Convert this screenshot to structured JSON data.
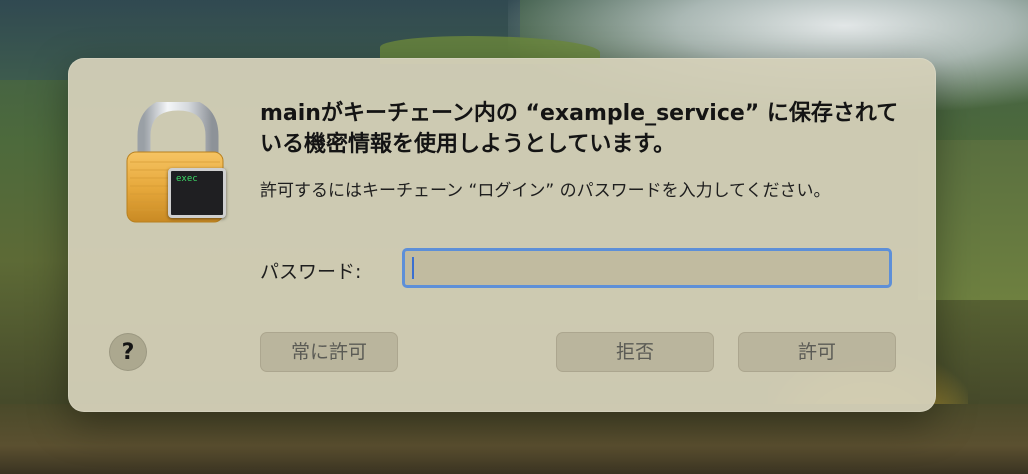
{
  "dialog": {
    "title": "mainがキーチェーン内の “example_service” に保存されている機密情報を使用しようとしています。",
    "message": "許可するにはキーチェーン “ログイン” のパスワードを入力してください。",
    "password_label": "パスワード:",
    "password_value": "",
    "password_placeholder": "",
    "lock_terminal_text": "exec",
    "buttons": {
      "help": "?",
      "always_allow": "常に許可",
      "deny": "拒否",
      "allow": "許可"
    }
  },
  "colors": {
    "focus_ring": "#5d8fd8",
    "lock_body": "#e7a93c",
    "terminal_text": "#3ddc68"
  },
  "icons": [
    "lock-icon",
    "terminal-icon",
    "help-icon"
  ]
}
